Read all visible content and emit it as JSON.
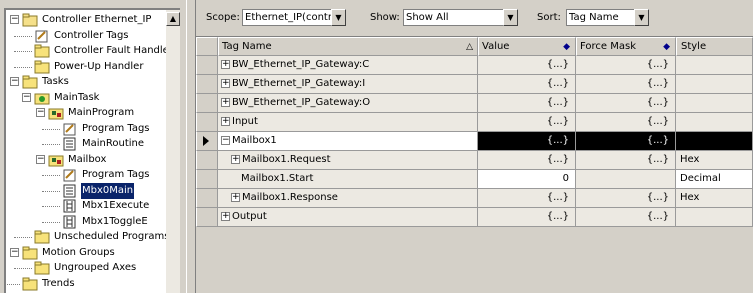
{
  "tree": {
    "items": [
      {
        "label": "Controller Ethernet_IP",
        "level": 0,
        "expander": "minus",
        "icon": "controller-folder-icon"
      },
      {
        "label": "Controller Tags",
        "level": 1,
        "expander": "",
        "icon": "tags-icon"
      },
      {
        "label": "Controller Fault Handler",
        "level": 1,
        "expander": "",
        "icon": "folder-icon"
      },
      {
        "label": "Power-Up Handler",
        "level": 1,
        "expander": "",
        "icon": "folder-icon"
      },
      {
        "label": "Tasks",
        "level": 0,
        "expander": "minus",
        "icon": "folder-icon"
      },
      {
        "label": "MainTask",
        "level": 1,
        "expander": "minus",
        "icon": "task-icon"
      },
      {
        "label": "MainProgram",
        "level": 2,
        "expander": "minus",
        "icon": "program-icon"
      },
      {
        "label": "Program Tags",
        "level": 3,
        "expander": "",
        "icon": "tags-icon"
      },
      {
        "label": "MainRoutine",
        "level": 3,
        "expander": "",
        "icon": "routine-icon"
      },
      {
        "label": "Mailbox",
        "level": 2,
        "expander": "minus",
        "icon": "program-icon"
      },
      {
        "label": "Program Tags",
        "level": 3,
        "expander": "",
        "icon": "tags-icon"
      },
      {
        "label": "Mbx0Main",
        "level": 3,
        "expander": "",
        "icon": "routine-icon",
        "selected": true
      },
      {
        "label": "Mbx1Execute",
        "level": 3,
        "expander": "",
        "icon": "ladder-icon"
      },
      {
        "label": "Mbx1ToggleE",
        "level": 3,
        "expander": "",
        "icon": "ladder-icon"
      },
      {
        "label": "Unscheduled Programs",
        "level": 1,
        "expander": "",
        "icon": "folder-icon"
      },
      {
        "label": "Motion Groups",
        "level": 0,
        "expander": "minus",
        "icon": "folder-icon"
      },
      {
        "label": "Ungrouped Axes",
        "level": 1,
        "expander": "",
        "icon": "folder-icon"
      },
      {
        "label": "Trends",
        "level": 0,
        "expander": "",
        "icon": "folder-icon"
      }
    ]
  },
  "toolbar": {
    "scope_label": "Scope:",
    "scope_value": "Ethernet_IP(controlle",
    "show_label": "Show:",
    "show_value": "Show All",
    "sort_label": "Sort:",
    "sort_value": "Tag Name"
  },
  "grid": {
    "headers": {
      "name": "Tag Name",
      "value": "Value",
      "force": "Force Mask",
      "style": "Style"
    },
    "rows": [
      {
        "name": "BW_Ethernet_IP_Gateway:C",
        "indent": 0,
        "expander": "+",
        "value": "{...}",
        "force": "{...}",
        "style": ""
      },
      {
        "name": "BW_Ethernet_IP_Gateway:I",
        "indent": 0,
        "expander": "+",
        "value": "{...}",
        "force": "{...}",
        "style": ""
      },
      {
        "name": "BW_Ethernet_IP_Gateway:O",
        "indent": 0,
        "expander": "+",
        "value": "{...}",
        "force": "{...}",
        "style": ""
      },
      {
        "name": "Input",
        "indent": 0,
        "expander": "+",
        "value": "{...}",
        "force": "{...}",
        "style": ""
      },
      {
        "name": "Mailbox1",
        "indent": 0,
        "expander": "−",
        "value": "{...}",
        "force": "{...}",
        "style": "",
        "current": true
      },
      {
        "name": "Mailbox1.Request",
        "indent": 1,
        "expander": "+",
        "value": "{...}",
        "force": "{...}",
        "style": "Hex"
      },
      {
        "name": "Mailbox1.Start",
        "indent": 2,
        "expander": "",
        "value": "0",
        "force": "",
        "style": "Decimal",
        "editable": true
      },
      {
        "name": "Mailbox1.Response",
        "indent": 1,
        "expander": "+",
        "value": "{...}",
        "force": "{...}",
        "style": "Hex"
      },
      {
        "name": "Output",
        "indent": 0,
        "expander": "+",
        "value": "{...}",
        "force": "{...}",
        "style": ""
      }
    ]
  },
  "colors": {
    "selection": "#0a246a",
    "current_row": "#000000",
    "window_bg": "#d4d0c8"
  }
}
